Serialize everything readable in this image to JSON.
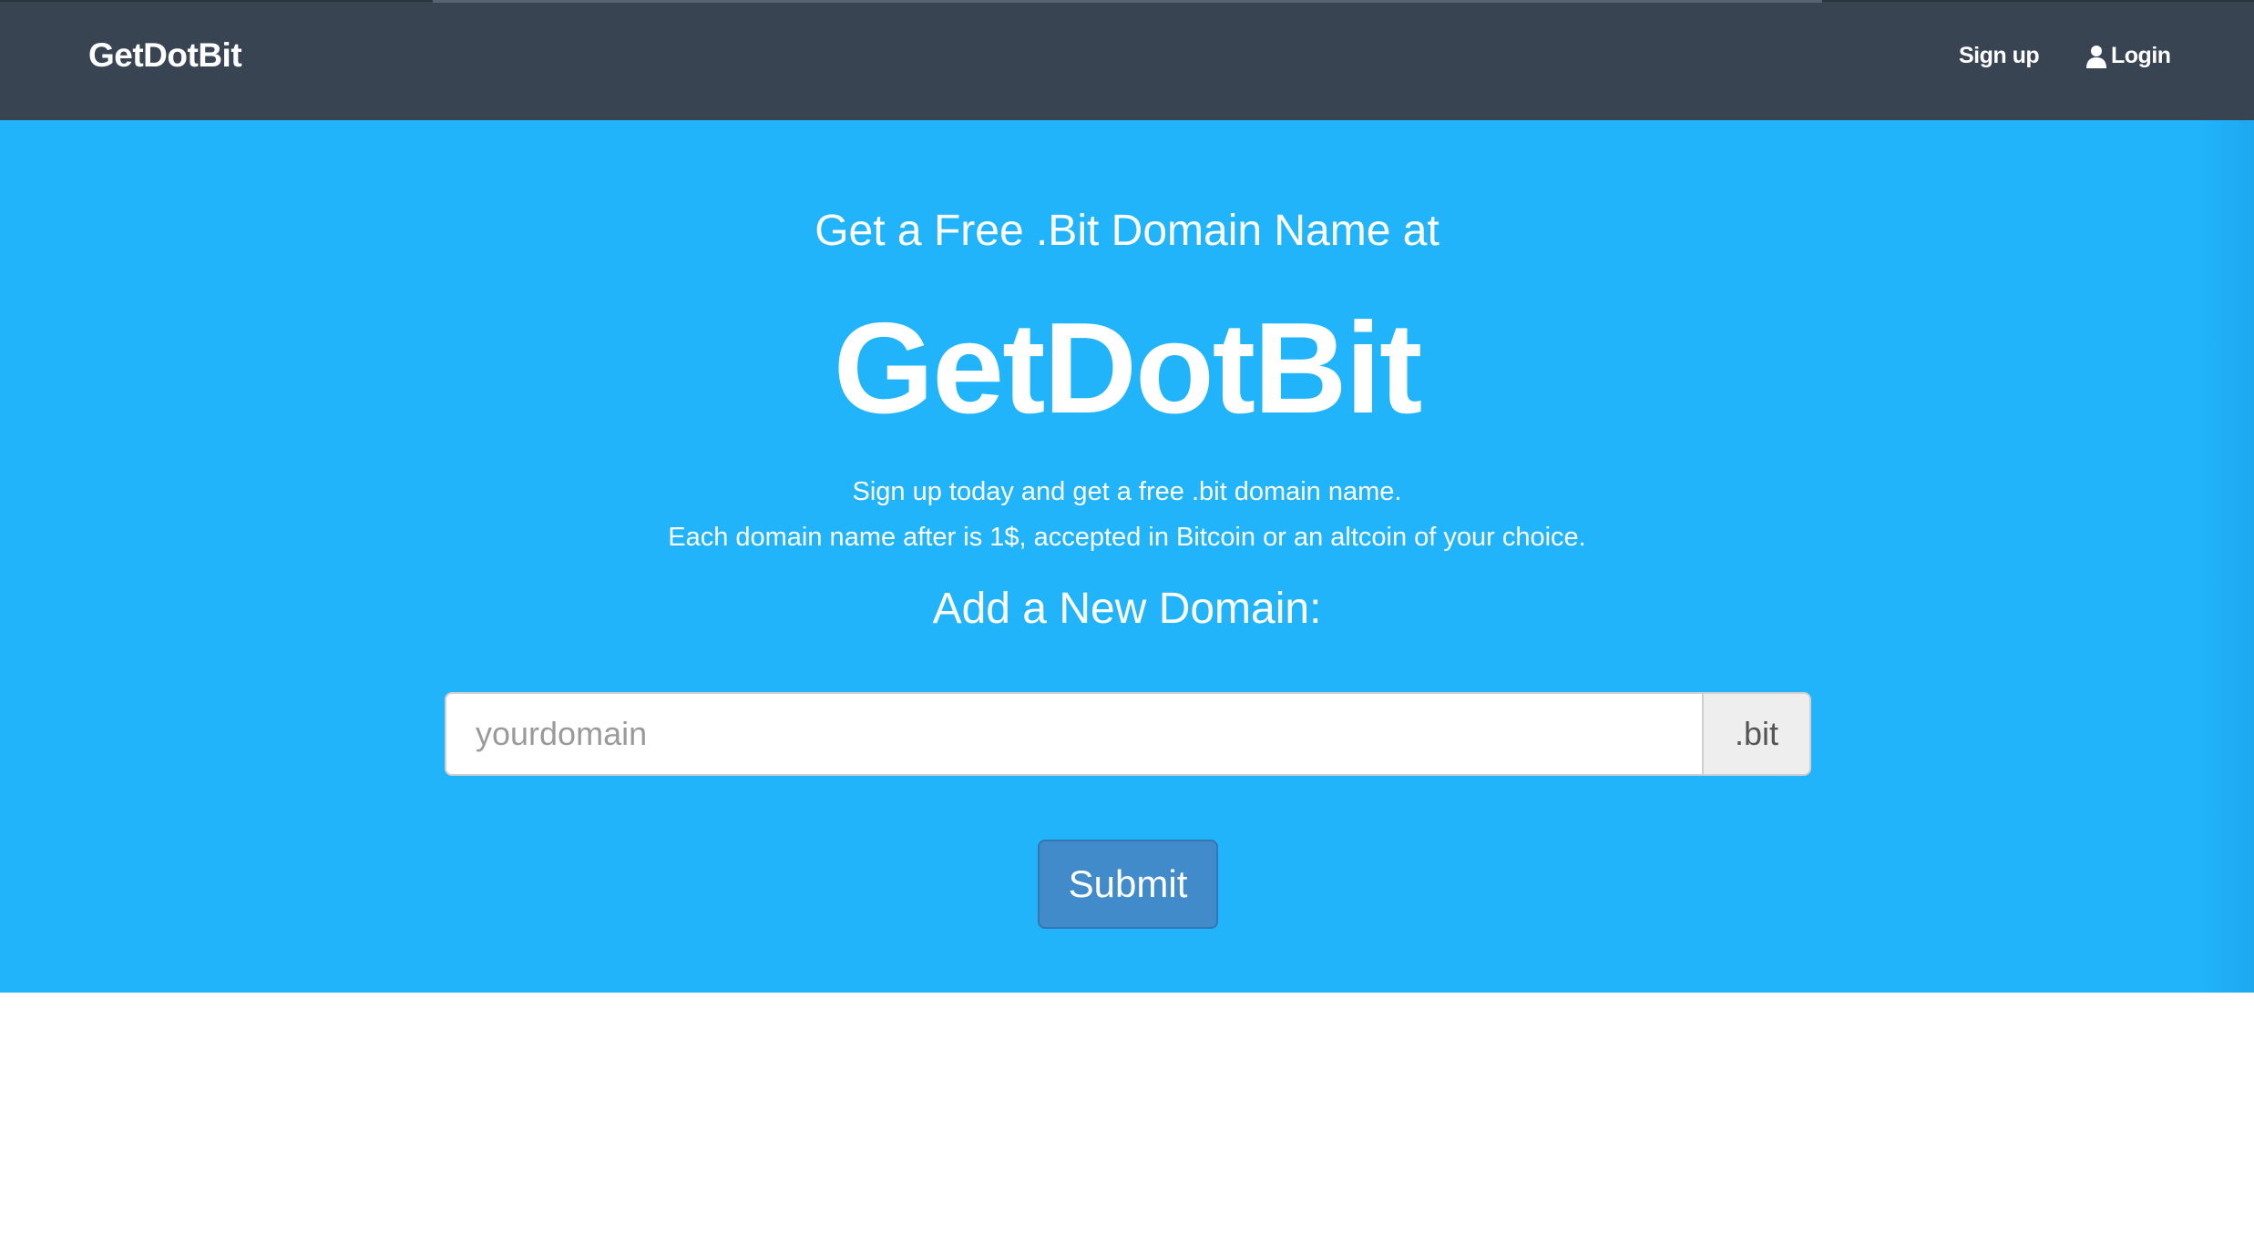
{
  "navbar": {
    "brand": "GetDotBit",
    "signup_label": "Sign up",
    "login_label": "Login",
    "login_icon": "user-icon",
    "background_color": "#394453"
  },
  "hero": {
    "background_color": "#21b4fb",
    "subheading": "Get a Free .Bit Domain Name at",
    "title": "GetDotBit",
    "description_line1": "Sign up today and get a free .bit domain name.",
    "description_line2": "Each domain name after is 1$, accepted in Bitcoin or an altcoin of your choice.",
    "add_domain_heading": "Add a New Domain:",
    "domain_input": {
      "value": "",
      "placeholder": "yourdomain"
    },
    "domain_suffix": ".bit",
    "submit_label": "Submit",
    "submit_color": "#428bca"
  }
}
